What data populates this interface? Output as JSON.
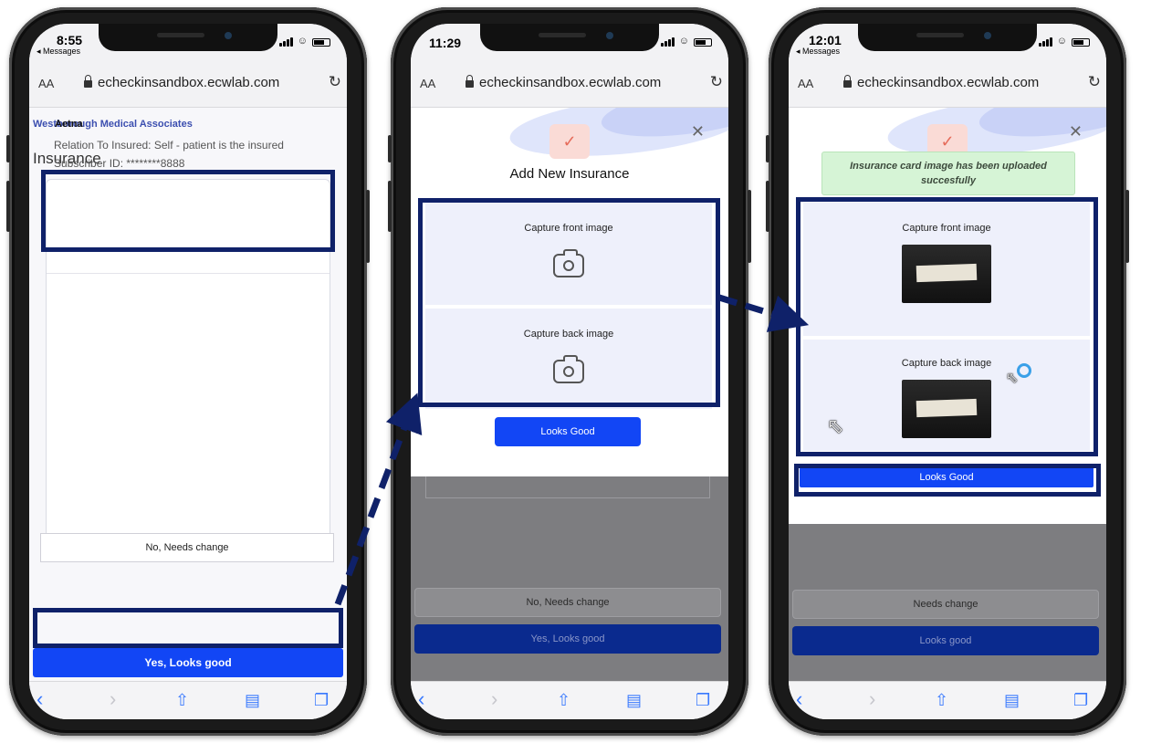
{
  "browser": {
    "aa_label": "AA",
    "url": "echeckinsandbox.ecwlab.com"
  },
  "phone1": {
    "time": "8:55",
    "back_app": "◂ Messages",
    "org_name": "Westborough Medical Associates",
    "section_heading": "Insurance",
    "insurance_card": {
      "name": "Aetna",
      "relation": "Relation To Insured: Self - patient is the insured",
      "subscriber": "Subscriber ID: ********8888"
    },
    "buttons": {
      "no_label": "No, Needs change",
      "yes_label": "Yes, Looks good"
    }
  },
  "phone2": {
    "time": "11:29",
    "modal_title": "Add New Insurance",
    "capture_front": "Capture front image",
    "capture_back": "Capture back image",
    "looks_good": "Looks Good",
    "bg_no_label": "No, Needs change",
    "bg_yes_label": "Yes, Looks good"
  },
  "phone3": {
    "time": "12:01",
    "back_app": "◂ Messages",
    "toast": "Insurance card image has been uploaded succesfully",
    "capture_front": "Capture front image",
    "capture_back": "Capture back image",
    "looks_good": "Looks Good",
    "bg_no_label": "Needs change",
    "bg_yes_label": "Looks good"
  },
  "icons": {
    "shield": "shield-check-icon",
    "camera": "camera-icon",
    "close": "close-icon",
    "reload": "reload-icon",
    "lock": "lock-icon",
    "back": "back-arrow-icon",
    "forward": "forward-arrow-icon",
    "share": "share-icon",
    "bookmarks": "bookmarks-icon",
    "tabs": "tabs-icon",
    "cursor": "mouse-cursor-icon"
  },
  "colors": {
    "highlight_border": "#0f2169",
    "primary_button": "#1246f5",
    "toast_bg": "#d6f4d6",
    "shield_bg": "#fadbd6"
  }
}
